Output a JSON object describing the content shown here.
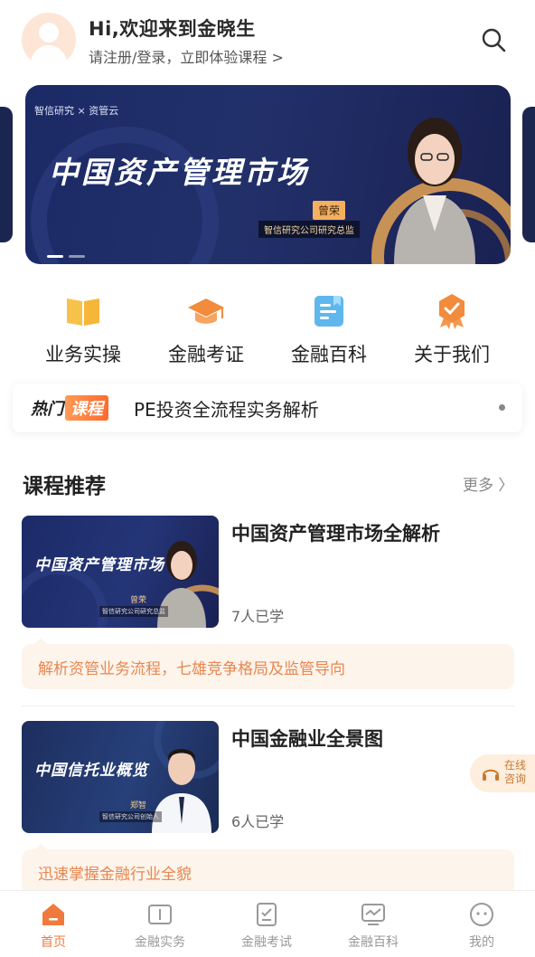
{
  "header": {
    "greeting": "Hi,欢迎来到金晓生",
    "subline": "请注册/登录，立即体验课程 >"
  },
  "banner": {
    "brand": "智信研究 × 资管云",
    "title": "中国资产管理市场",
    "speaker_name": "曾荣",
    "speaker_role": "智信研究公司研究总监"
  },
  "menu": {
    "items": [
      {
        "label": "业务实操",
        "icon": "book-icon"
      },
      {
        "label": "金融考证",
        "icon": "graduation-cap-icon"
      },
      {
        "label": "金融百科",
        "icon": "encyclopedia-icon"
      },
      {
        "label": "关于我们",
        "icon": "badge-icon"
      }
    ]
  },
  "hot": {
    "tag_part1": "热门",
    "tag_part2": "课程",
    "text": "PE投资全流程实务解析"
  },
  "section": {
    "title": "课程推荐",
    "more": "更多 〉"
  },
  "courses": [
    {
      "thumb_title": "中国资产管理市场",
      "thumb_name": "曾荣",
      "thumb_role": "智信研究公司研究总监",
      "title": "中国资产管理市场全解析",
      "learned": "7人已学",
      "desc": "解析资管业务流程，七雄竞争格局及监管导向"
    },
    {
      "thumb_title": "中国信托业概览",
      "thumb_name": "郑智",
      "thumb_role": "智信研究公司创始人",
      "title": "中国金融业全景图",
      "learned": "6人已学",
      "desc": "迅速掌握金融行业全貌"
    }
  ],
  "consult": {
    "label": "在线咨询"
  },
  "tabbar": {
    "tabs": [
      {
        "label": "首页",
        "active": true
      },
      {
        "label": "金融实务",
        "active": false
      },
      {
        "label": "金融考试",
        "active": false
      },
      {
        "label": "金融百科",
        "active": false
      },
      {
        "label": "我的",
        "active": false
      }
    ]
  },
  "colors": {
    "accent": "#f07a3e",
    "banner_bg": "#1b2a66",
    "desc_bg": "#fdf4ec"
  }
}
